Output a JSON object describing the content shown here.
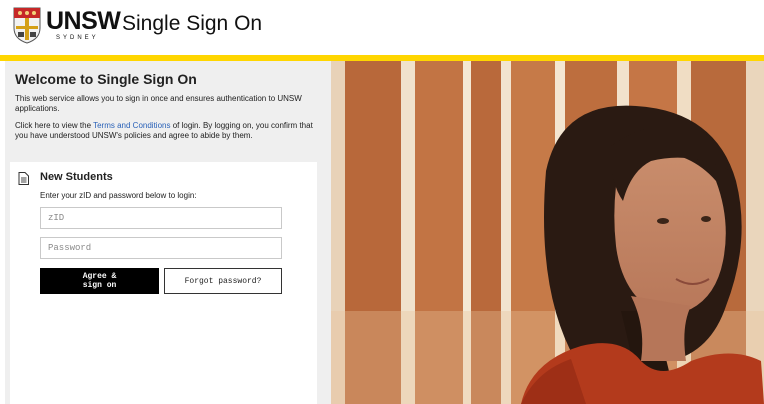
{
  "header": {
    "logo_text": "UNSW",
    "logo_subtext": "SYDNEY",
    "title": "Single Sign On"
  },
  "welcome": {
    "title": "Welcome to Single Sign On",
    "intro": "This web service allows you to sign in once and ensures authentication to UNSW applications.",
    "terms_prefix": "Click here to view the ",
    "terms_link": "Terms and Conditions",
    "terms_suffix": " of login. By logging on, you confirm that you have understood UNSW's policies and agree to abide by them."
  },
  "login": {
    "heading": "New Students",
    "subheading": "Enter your zID and password below to login:",
    "zid_placeholder": "zID",
    "password_placeholder": "Password",
    "agree_label": "Agree &\nsign on",
    "forgot_label": "Forgot password?"
  },
  "colors": {
    "accent": "#ffd600",
    "link": "#2a62b8",
    "primary_button": "#000000"
  },
  "icons": {
    "logo": "unsw-crest-icon",
    "heading": "document-icon"
  }
}
